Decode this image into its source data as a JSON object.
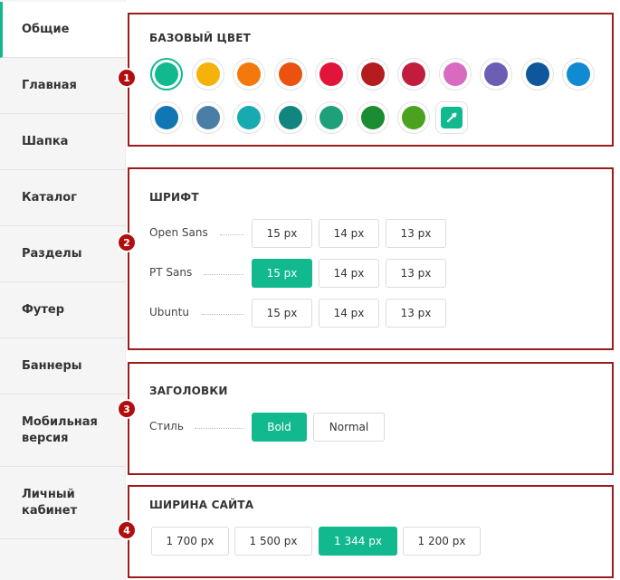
{
  "sidebar": {
    "items": [
      {
        "label": "Общие"
      },
      {
        "label": "Главная"
      },
      {
        "label": "Шапка"
      },
      {
        "label": "Каталог"
      },
      {
        "label": "Разделы"
      },
      {
        "label": "Футер"
      },
      {
        "label": "Баннеры"
      },
      {
        "label": "Мобильная\nверсия"
      },
      {
        "label": "Личный\nкабинет"
      }
    ]
  },
  "badges": [
    "1",
    "2",
    "3",
    "4"
  ],
  "base_color": {
    "title": "БАЗОВЫЙ ЦВЕТ",
    "swatches": [
      "#12b98f",
      "#f5b20a",
      "#f3790c",
      "#e9520f",
      "#e1153a",
      "#b51c1e",
      "#c21c3c",
      "#d86bbf",
      "#6c5eb5",
      "#0f579b",
      "#108ad0",
      "#1176b4",
      "#4b7ea5",
      "#17aab1",
      "#12867e",
      "#1ea07b",
      "#1c8c32",
      "#4ba21e"
    ],
    "selected_index": 0,
    "picker_color": "#12b98f"
  },
  "font": {
    "title": "ШРИФТ",
    "rows": [
      {
        "name": "Open Sans",
        "options": [
          "15 px",
          "14 px",
          "13 px"
        ],
        "active": -1
      },
      {
        "name": "PT Sans",
        "options": [
          "15 px",
          "14 px",
          "13 px"
        ],
        "active": 0
      },
      {
        "name": "Ubuntu",
        "options": [
          "15 px",
          "14 px",
          "13 px"
        ],
        "active": -1
      }
    ]
  },
  "headings": {
    "title": "ЗАГОЛОВКИ",
    "style_label": "Стиль",
    "options": [
      "Bold",
      "Normal"
    ],
    "active": 0
  },
  "site_width": {
    "title": "ШИРИНА САЙТА",
    "options": [
      "1 700 px",
      "1 500 px",
      "1 344 px",
      "1 200 px"
    ],
    "active": 2
  },
  "accent": "#12b98f",
  "frame_color": "#9b1c1c"
}
